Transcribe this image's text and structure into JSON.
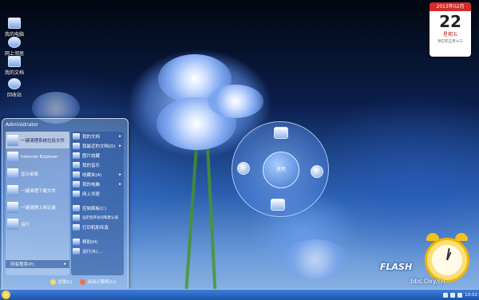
{
  "desktop": {
    "icons": [
      {
        "label": "我的电脑",
        "icon": "computer-icon"
      },
      {
        "label": "网上邻居",
        "icon": "network-icon"
      },
      {
        "label": "我的文档",
        "icon": "documents-icon"
      },
      {
        "label": "回收站",
        "icon": "recycle-bin-icon"
      }
    ]
  },
  "start_menu": {
    "user": "Administrator",
    "pinned": [
      {
        "label": "一键清理系统垃圾文件",
        "icon": "cleanup-icon"
      },
      {
        "label": "Internet Explorer",
        "icon": "ie-icon"
      },
      {
        "label": "显示桌面",
        "icon": "desktop-icon"
      },
      {
        "label": "一键清理下载文件",
        "icon": "download-cleanup-icon"
      },
      {
        "label": "一键清理上网记录",
        "icon": "history-cleanup-icon"
      },
      {
        "label": "运行",
        "icon": "run-icon"
      }
    ],
    "all_programs": "所有程序(P)",
    "right": [
      {
        "label": "我的文档",
        "arrow": "▸"
      },
      {
        "label": "我最近的文档(D)",
        "arrow": "▸"
      },
      {
        "label": "图片收藏",
        "arrow": ""
      },
      {
        "label": "我的音乐",
        "arrow": ""
      },
      {
        "label": "收藏夹(A)",
        "arrow": "▸"
      },
      {
        "label": "我的电脑",
        "arrow": "▸"
      },
      {
        "label": "网上邻居",
        "arrow": ""
      },
      {
        "label": "控制面板(C)",
        "arrow": ""
      },
      {
        "label": "设定程序访问和默认值",
        "arrow": ""
      },
      {
        "label": "打印机和传真",
        "arrow": ""
      },
      {
        "label": "帮助(H)",
        "arrow": ""
      },
      {
        "label": "运行(R)...",
        "arrow": ""
      }
    ],
    "logoff": "注销(L)",
    "shutdown": "关闭计算机(U)"
  },
  "radial_widget": {
    "center_label": "迷亮"
  },
  "calendar": {
    "month": "2013年02月",
    "day": "22",
    "weekday": "星期五",
    "lunar": "癸巳年正月十三"
  },
  "watermark": {
    "logo": "FLASH",
    "site": "bbs.Oxy.cn"
  },
  "taskbar": {
    "clock": "10:02"
  }
}
